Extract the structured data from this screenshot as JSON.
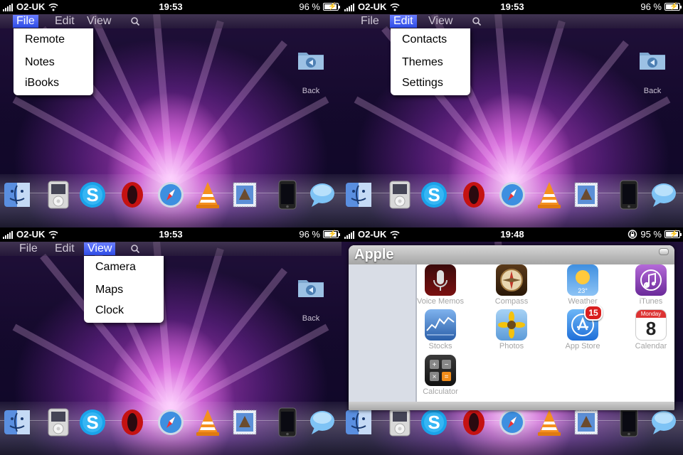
{
  "status": {
    "top_left": {
      "carrier": "O2-UK",
      "time": "19:53",
      "battery": "96 %"
    },
    "top_right": {
      "carrier": "O2-UK",
      "time": "19:53",
      "battery": "96 %"
    },
    "bottom_left": {
      "carrier": "O2-UK",
      "time": "19:53",
      "battery": "96 %"
    },
    "bottom_right": {
      "carrier": "O2-UK",
      "time": "19:48",
      "battery": "95 %"
    }
  },
  "menubar": {
    "file": "File",
    "edit": "Edit",
    "view": "View"
  },
  "menus": {
    "file": [
      "Remote",
      "Notes",
      "iBooks"
    ],
    "edit": [
      "Contacts",
      "Themes",
      "Settings"
    ],
    "view": [
      "Camera",
      "Maps",
      "Clock"
    ]
  },
  "back_label": "Back",
  "dock": [
    "finder-icon",
    "ipod-icon",
    "skype-icon",
    "opera-icon",
    "safari-icon",
    "vlc-icon",
    "mail-icon",
    "iphone-icon",
    "messages-icon"
  ],
  "window": {
    "title": "Apple",
    "apps": [
      {
        "label": "Voice Memos"
      },
      {
        "label": "Compass"
      },
      {
        "label": "Weather",
        "temp": "23°"
      },
      {
        "label": "iTunes"
      },
      {
        "label": "Stocks"
      },
      {
        "label": "Photos"
      },
      {
        "label": "App Store",
        "badge": "15"
      },
      {
        "label": "Calendar",
        "day": "Monday",
        "date": "8"
      },
      {
        "label": "Calculator"
      }
    ]
  }
}
